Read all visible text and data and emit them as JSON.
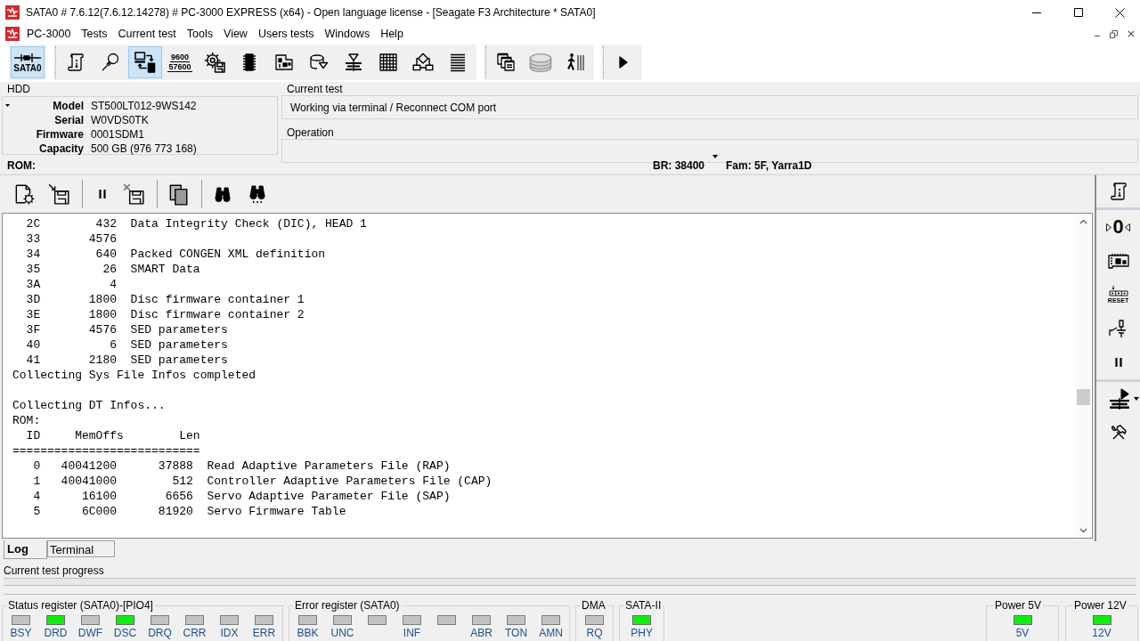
{
  "window": {
    "title": "SATA0 # 7.6.12(7.6.12.14278) # PC-3000 EXPRESS (x64) - Open language license - [Seagate F3 Architecture * SATA0]"
  },
  "menu": [
    "PC-3000",
    "Tests",
    "Current test",
    "Tools",
    "View",
    "Users tests",
    "Windows",
    "Help"
  ],
  "toolbar": {
    "port_button": {
      "label": "SATA0",
      "selected": true
    },
    "groups": [
      [
        {
          "selected": false
        },
        {
          "selected": false
        },
        {
          "selected": true
        },
        {
          "selected": false,
          "lines": [
            "9600",
            "57600"
          ]
        },
        {
          "selected": false
        },
        {
          "selected": false
        },
        {
          "selected": false
        },
        {
          "selected": false
        },
        {
          "selected": false
        },
        {
          "selected": false
        },
        {
          "selected": false
        },
        {
          "selected": false
        }
      ],
      [
        {
          "selected": false
        },
        {
          "selected": false
        },
        {
          "selected": false
        }
      ],
      [
        {
          "selected": false
        }
      ]
    ]
  },
  "info": {
    "hdd": {
      "title": "HDD",
      "fields": [
        {
          "label": "Model",
          "value": "ST500LT012-9WS142"
        },
        {
          "label": "Serial",
          "value": "W0VDS0TK"
        },
        {
          "label": "Firmware",
          "value": "0001SDM1"
        },
        {
          "label": "Capacity",
          "value": "500 GB (976 773 168)"
        }
      ]
    },
    "current_test": {
      "title": "Current test",
      "value": "Working via terminal / Reconnect COM port"
    },
    "operation": {
      "title": "Operation"
    }
  },
  "status_line": {
    "area": "ROM:",
    "baud_rate": "BR: 38400",
    "family": "Fam: 5F, Yarra1D"
  },
  "log": {
    "sections": [
      [
        "  2C        432  Data Integrity Check (DIC), HEAD 1",
        "  33       4576",
        "  34        640  Packed CONGEN XML definition",
        "  35         26  SMART Data",
        "  3A          4",
        "  3D       1800  Disc firmware container 1",
        "  3E       1800  Disc firmware container 2",
        "  3F       4576  SED parameters",
        "  40          6  SED parameters",
        "  41       2180  SED parameters",
        "Collecting Sys File Infos completed"
      ],
      [
        "Collecting DT Infos...",
        "ROM:",
        "  ID     MemOffs        Len",
        "===========================",
        "   0   40041200      37888  Read Adaptive Parameters File (RAP)",
        "   1   40041000        512  Controller Adaptive Parameters File (CAP)",
        "   4      16100       6656  Servo Adaptive Parameter File (SAP)",
        "   5      6C000      81920  Servo Firmware Table"
      ]
    ]
  },
  "side_toolbar": {
    "zero_label": "0",
    "reset_label": "RESET"
  },
  "tabs": [
    {
      "label": "Log",
      "selected": true
    },
    {
      "label": "Terminal",
      "selected": false
    }
  ],
  "progress": {
    "label": "Current test progress",
    "level": 0
  },
  "indicator_groups": [
    {
      "title": "Status register (SATA0)-[PIO4]",
      "lights": [
        {
          "label": "BSY",
          "on": false
        },
        {
          "label": "DRD",
          "on": true
        },
        {
          "label": "DWF",
          "on": false
        },
        {
          "label": "DSC",
          "on": true
        },
        {
          "label": "DRQ",
          "on": false
        },
        {
          "label": "CRR",
          "on": false
        },
        {
          "label": "IDX",
          "on": false
        },
        {
          "label": "ERR",
          "on": false
        }
      ]
    },
    {
      "title": "Error register (SATA0)",
      "lights": [
        {
          "label": "BBK",
          "on": false
        },
        {
          "label": "UNC",
          "on": false
        },
        {
          "on": false
        },
        {
          "label": "INF",
          "on": false
        },
        {
          "on": false
        },
        {
          "label": "ABR",
          "on": false
        },
        {
          "label": "TON",
          "on": false
        },
        {
          "label": "AMN",
          "on": false
        }
      ]
    },
    {
      "title": "DMA",
      "lights": [
        {
          "label": "RQ",
          "on": false
        }
      ]
    },
    {
      "title": "SATA-II",
      "lights": [
        {
          "label": "PHY",
          "on": true
        }
      ]
    }
  ],
  "power_groups": [
    {
      "title": "Power 5V",
      "lights": [
        {
          "label": "5V",
          "on": true
        }
      ]
    },
    {
      "title": "Power 12V",
      "lights": [
        {
          "label": "12V",
          "on": true
        }
      ]
    }
  ]
}
